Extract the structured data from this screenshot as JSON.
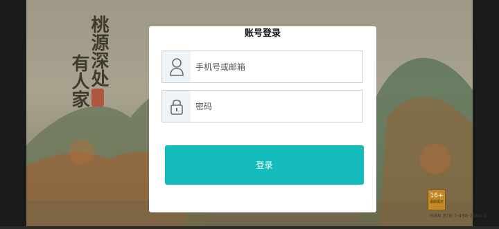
{
  "background": {
    "game_title": [
      "桃源深处",
      "有人家"
    ],
    "age_rating": "16+",
    "age_rating_caption": "适龄提示",
    "isbn_text": "ISBN 978-7-498-2304-2"
  },
  "dialog": {
    "title": "账号登录",
    "username": {
      "value": "",
      "placeholder": "手机号或邮箱",
      "icon": "user-icon"
    },
    "password": {
      "value": "",
      "placeholder": "密码",
      "icon": "lock-icon"
    },
    "login_label": "登录",
    "accent_color": "#14bdbb"
  }
}
